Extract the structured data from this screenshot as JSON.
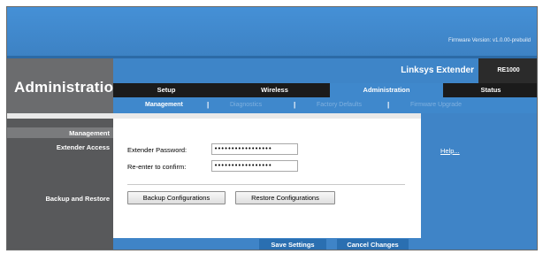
{
  "header": {
    "firmware_label": "Firmware Version:  v1.0.00-prebuild",
    "product_name": "Linksys Extender",
    "model": "RE1000"
  },
  "section_title": "Administration",
  "tabs": [
    {
      "label": "Setup",
      "active": false
    },
    {
      "label": "Wireless",
      "active": false
    },
    {
      "label": "Administration",
      "active": true
    },
    {
      "label": "Status",
      "active": false
    }
  ],
  "submenu": [
    {
      "label": "Management",
      "active": true
    },
    {
      "label": "Diagnostics",
      "active": false
    },
    {
      "label": "Factory Defaults",
      "active": false
    },
    {
      "label": "Firmware Upgrade",
      "active": false
    }
  ],
  "left_labels": {
    "management": "Management",
    "extender_access": "Extender Access",
    "backup_restore": "Backup and Restore"
  },
  "form": {
    "password_label": "Extender Password:",
    "password_value": "•••••••••••••••••",
    "confirm_label": "Re-enter to  confirm:",
    "confirm_value": "•••••••••••••••••"
  },
  "buttons": {
    "backup": "Backup Configurations",
    "restore": "Restore Configurations",
    "save": "Save Settings",
    "cancel": "Cancel Changes"
  },
  "help": {
    "link": "Help..."
  },
  "colors": {
    "brand_blue": "#3f84c7",
    "dark_gray": "#58595b",
    "tab_bar": "#1b1b1b"
  }
}
